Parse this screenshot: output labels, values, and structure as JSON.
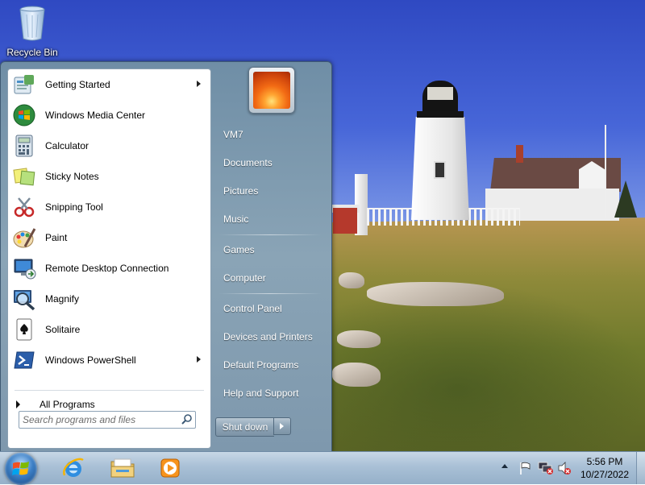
{
  "desktop": {
    "icons": [
      {
        "label": "Recycle Bin",
        "icon": "recycle-bin-icon"
      }
    ]
  },
  "start_menu": {
    "programs": [
      {
        "label": "Getting Started",
        "icon": "getting-started-icon",
        "has_submenu": true
      },
      {
        "label": "Windows Media Center",
        "icon": "windows-media-center-icon",
        "has_submenu": false
      },
      {
        "label": "Calculator",
        "icon": "calculator-icon",
        "has_submenu": false
      },
      {
        "label": "Sticky Notes",
        "icon": "sticky-notes-icon",
        "has_submenu": false
      },
      {
        "label": "Snipping Tool",
        "icon": "snipping-tool-icon",
        "has_submenu": false
      },
      {
        "label": "Paint",
        "icon": "paint-icon",
        "has_submenu": false
      },
      {
        "label": "Remote Desktop Connection",
        "icon": "remote-desktop-icon",
        "has_submenu": false
      },
      {
        "label": "Magnify",
        "icon": "magnify-icon",
        "has_submenu": false
      },
      {
        "label": "Solitaire",
        "icon": "solitaire-icon",
        "has_submenu": false
      },
      {
        "label": "Windows PowerShell",
        "icon": "powershell-icon",
        "has_submenu": true
      }
    ],
    "all_programs_label": "All Programs",
    "search_placeholder": "Search programs and files",
    "user_picture_icon": "user-picture-flower",
    "right_items": [
      "VM7",
      "Documents",
      "Pictures",
      "Music",
      "Games",
      "Computer",
      "Control Panel",
      "Devices and Printers",
      "Default Programs",
      "Help and Support"
    ],
    "shutdown_label": "Shut down"
  },
  "taskbar": {
    "pinned": [
      {
        "name": "Internet Explorer",
        "icon": "internet-explorer-icon"
      },
      {
        "name": "Windows Explorer",
        "icon": "folder-icon"
      },
      {
        "name": "Windows Media Player",
        "icon": "media-player-icon"
      }
    ],
    "tray_icons": [
      "action-center-flag-icon",
      "network-icon",
      "volume-muted-icon"
    ],
    "clock": {
      "time": "5:56 PM",
      "date": "10/27/2022"
    }
  }
}
